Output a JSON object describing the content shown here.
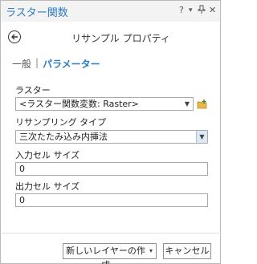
{
  "pane": {
    "title": "ラスター関数",
    "help": "?",
    "pin_menu": "▾",
    "pin": "⊓",
    "close": "✕"
  },
  "header": {
    "title": "リサンプル プロパティ"
  },
  "tabs": [
    {
      "label": "一般"
    },
    {
      "label": "パラメーター",
      "active": true
    }
  ],
  "tab_separator": "|",
  "fields": {
    "raster": {
      "label": "ラスター",
      "value": "<ラスター関数変数: Raster>"
    },
    "resampling_type": {
      "label": "リサンプリング タイプ",
      "value": "三次たたみ込み内挿法"
    },
    "input_cell_size": {
      "label": "入力セル サイズ",
      "value": "0"
    },
    "output_cell_size": {
      "label": "出力セル サイズ",
      "value": "0"
    }
  },
  "buttons": {
    "create_new_layer": "新しいレイヤーの作成",
    "cancel": "キャンセル"
  },
  "colors": {
    "accent": "#2b7bc7",
    "folder": "#e9b84a"
  },
  "icons": {
    "back": "back-arrow-icon",
    "browse": "folder-add-icon",
    "dropdown": "chevron-down-icon"
  }
}
